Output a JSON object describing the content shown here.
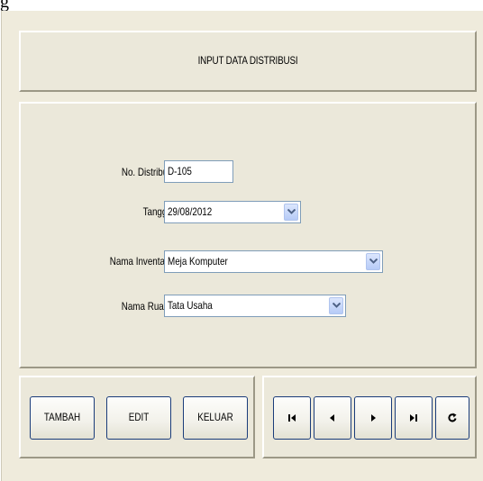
{
  "header": {
    "title": "INPUT DATA DISTRIBUSI"
  },
  "form": {
    "no_distribusi": {
      "label": "No. Distribusi",
      "value": "D-105"
    },
    "tanggal": {
      "label": "Tanggal",
      "value": "29/08/2012"
    },
    "nama_inventaris": {
      "label": "Nama Inventaris",
      "value": "Meja Komputer"
    },
    "nama_ruang": {
      "label": "Nama Ruang",
      "value": "Tata Usaha"
    }
  },
  "buttons": {
    "tambah": "TAMBAH",
    "edit": "EDIT",
    "keluar": "KELUAR"
  },
  "navigation": {
    "icons": [
      "first-record-icon",
      "previous-record-icon",
      "next-record-icon",
      "last-record-icon",
      "refresh-icon"
    ]
  },
  "colors": {
    "window_bg": "#efebdc",
    "button_border": "#1a3c7a",
    "combo_arrow": "#4d6185"
  }
}
